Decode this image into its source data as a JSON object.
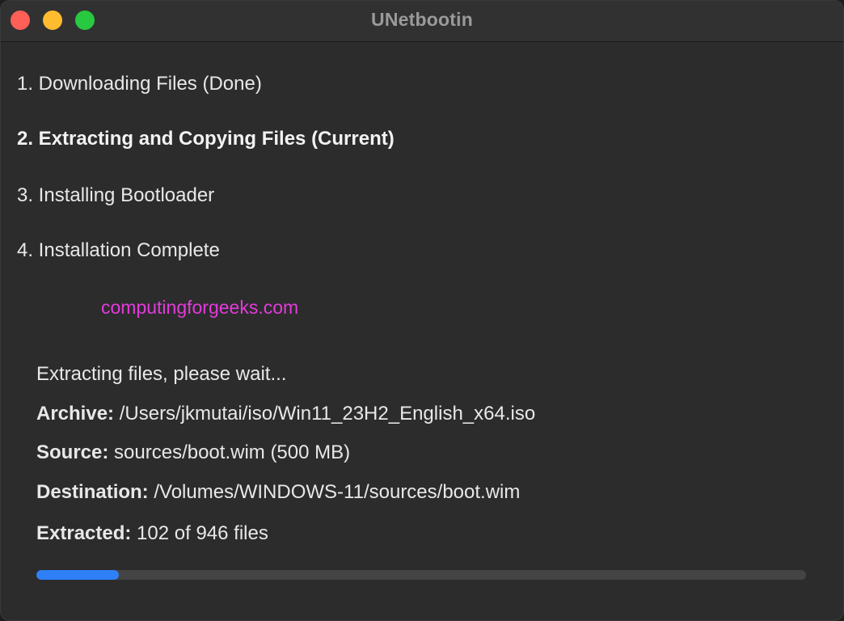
{
  "window": {
    "title": "UNetbootin"
  },
  "colors": {
    "close": "#fe5f57",
    "minimize": "#febc2e",
    "maximize": "#28c840",
    "progress": "#2f7ff7"
  },
  "steps": [
    {
      "label": "1. Downloading Files (Done)",
      "state": "done"
    },
    {
      "label": "2. Extracting and Copying Files (Current)",
      "state": "current"
    },
    {
      "label": "3. Installing Bootloader",
      "state": "pending"
    },
    {
      "label": "4. Installation Complete",
      "state": "pending"
    }
  ],
  "watermark": "computingforgeeks.com",
  "status": {
    "message": "Extracting files, please wait...",
    "archive_label": "Archive:",
    "archive_value": "/Users/jkmutai/iso/Win11_23H2_English_x64.iso",
    "source_label": "Source:",
    "source_value": "sources/boot.wim (500 MB)",
    "destination_label": "Destination:",
    "destination_value": "/Volumes/WINDOWS-11/sources/boot.wim",
    "extracted_label": "Extracted:",
    "extracted_value": "102 of 946 files"
  },
  "progress": {
    "fraction": 0.107
  }
}
